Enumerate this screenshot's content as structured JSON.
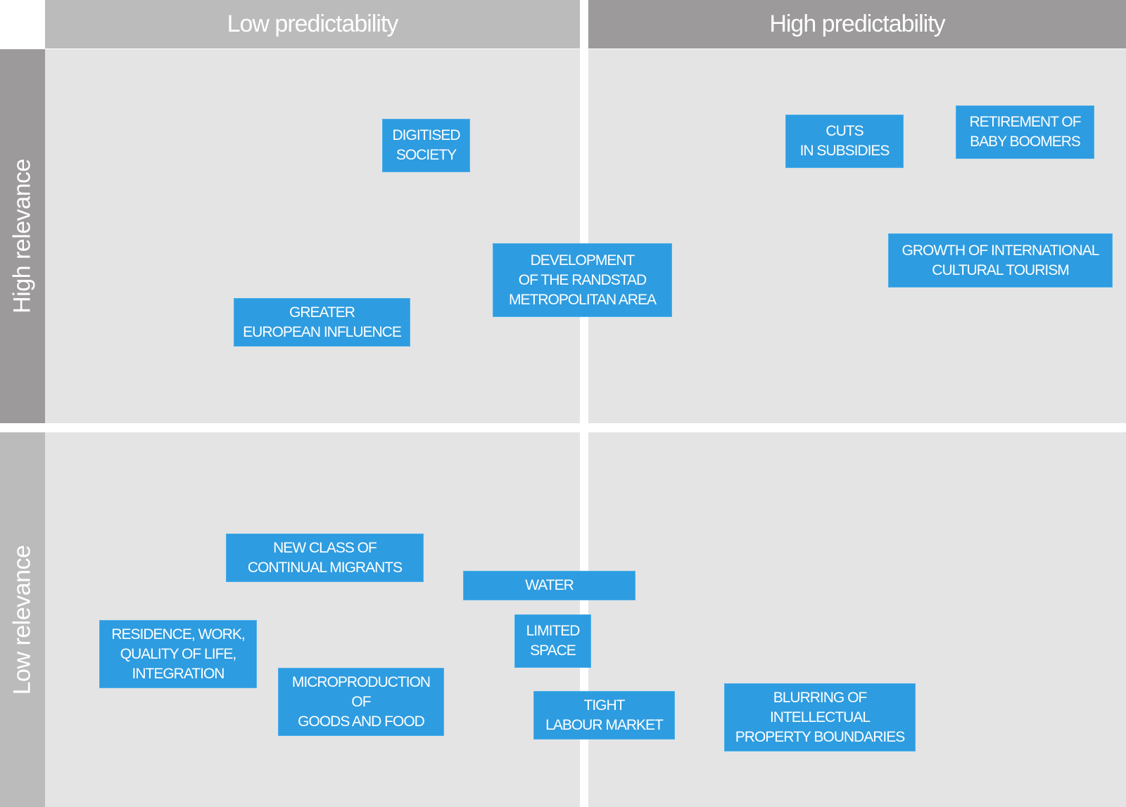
{
  "columns": {
    "low_predictability": "Low predictability",
    "high_predictability": "High predictability"
  },
  "rows": {
    "high_relevance": "High relevance",
    "low_relevance": "Low relevance"
  },
  "colors": {
    "box_fill": "#2e9ce0",
    "quadrant_bg": "#e4e4e4",
    "header_light": "#bbbbbb",
    "header_dark": "#9c9a9b"
  },
  "items": [
    {
      "id": "digitised-society",
      "lines": [
        "DIGITISED",
        "SOCIETY"
      ],
      "quadrant": "high-relevance/low-predictability"
    },
    {
      "id": "development-randstad",
      "lines": [
        "DEVELOPMENT",
        "OF THE RANDSTAD",
        "METROPOLITAN AREA"
      ],
      "quadrant": "high-relevance/boundary"
    },
    {
      "id": "greater-european-influence",
      "lines": [
        "GREATER",
        "EUROPEAN INFLUENCE"
      ],
      "quadrant": "high-relevance/low-predictability"
    },
    {
      "id": "cuts-in-subsidies",
      "lines": [
        "CUTS",
        "IN SUBSIDIES"
      ],
      "quadrant": "high-relevance/high-predictability"
    },
    {
      "id": "retirement-baby-boomers",
      "lines": [
        "RETIREMENT OF",
        "BABY BOOMERS"
      ],
      "quadrant": "high-relevance/high-predictability"
    },
    {
      "id": "growth-cultural-tourism",
      "lines": [
        "GROWTH OF INTERNATIONAL",
        "CULTURAL TOURISM"
      ],
      "quadrant": "high-relevance/high-predictability"
    },
    {
      "id": "new-class-migrants",
      "lines": [
        "NEW CLASS OF",
        "CONTINUAL MIGRANTS"
      ],
      "quadrant": "low-relevance/low-predictability"
    },
    {
      "id": "water",
      "lines": [
        "WATER"
      ],
      "quadrant": "low-relevance/boundary"
    },
    {
      "id": "residence-work",
      "lines": [
        "RESIDENCE, WORK,",
        "QUALITY OF LIFE,",
        "INTEGRATION"
      ],
      "quadrant": "low-relevance/low-predictability"
    },
    {
      "id": "limited-space",
      "lines": [
        "LIMITED",
        "SPACE"
      ],
      "quadrant": "low-relevance/low-predictability"
    },
    {
      "id": "microproduction",
      "lines": [
        "MICROPRODUCTION",
        "OF",
        "GOODS AND FOOD"
      ],
      "quadrant": "low-relevance/low-predictability"
    },
    {
      "id": "tight-labour-market",
      "lines": [
        "TIGHT",
        "LABOUR MARKET"
      ],
      "quadrant": "low-relevance/boundary"
    },
    {
      "id": "blurring-ip",
      "lines": [
        "BLURRING OF",
        "INTELLECTUAL",
        "PROPERTY BOUNDARIES"
      ],
      "quadrant": "low-relevance/high-predictability"
    }
  ]
}
